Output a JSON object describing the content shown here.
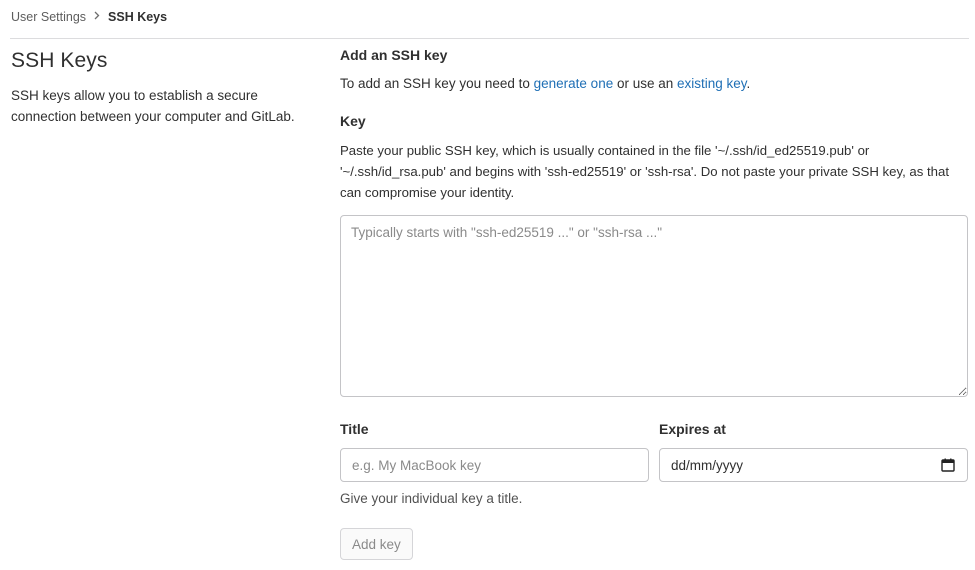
{
  "breadcrumb": {
    "parent": "User Settings",
    "separator_icon": "chevron-right-icon",
    "current": "SSH Keys"
  },
  "sidebar": {
    "title": "SSH Keys",
    "description": "SSH keys allow you to establish a secure connection between your computer and GitLab."
  },
  "form": {
    "heading": "Add an SSH key",
    "intro": {
      "prefix": "To add an SSH key you need to ",
      "link1": "generate one",
      "middle": " or use an ",
      "link2": "existing key",
      "suffix": "."
    },
    "key_label": "Key",
    "key_help": "Paste your public SSH key, which is usually contained in the file '~/.ssh/id_ed25519.pub' or '~/.ssh/id_rsa.pub' and begins with 'ssh-ed25519' or 'ssh-rsa'. Do not paste your private SSH key, as that can compromise your identity.",
    "key_placeholder": "Typically starts with \"ssh-ed25519 ...\" or \"ssh-rsa ...\"",
    "key_value": "",
    "title_label": "Title",
    "title_placeholder": "e.g. My MacBook key",
    "title_help": "Give your individual key a title.",
    "expires_label": "Expires at",
    "expires_value": "dd/mm/yyyy",
    "expires_icon": "calendar-icon",
    "submit_label": "Add key",
    "submit_disabled": true
  },
  "colors": {
    "link": "#1f6fb5",
    "text": "#303030",
    "border": "#c4c4c7",
    "placeholder": "#8a8a8a"
  }
}
